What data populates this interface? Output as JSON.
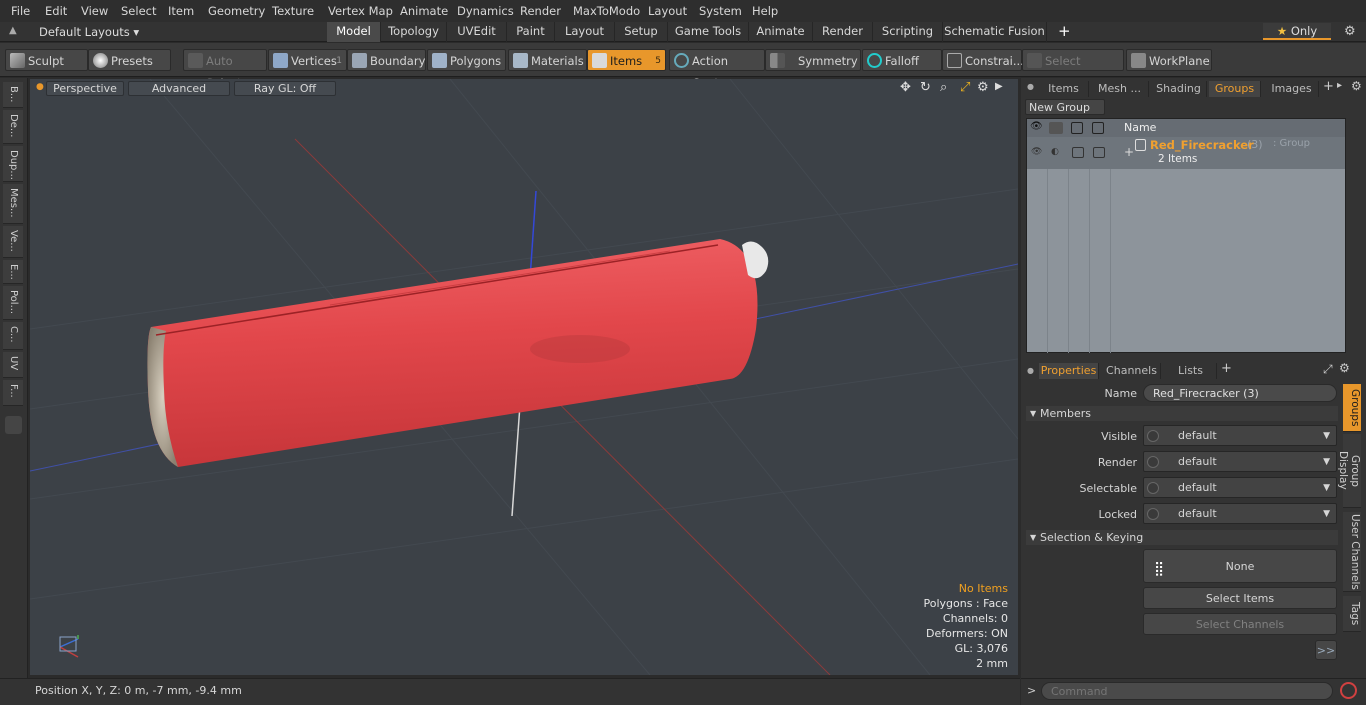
{
  "menu": [
    "File",
    "Edit",
    "View",
    "Select",
    "Item",
    "Geometry",
    "Texture",
    "Vertex Map",
    "Animate",
    "Dynamics",
    "Render",
    "MaxToModo",
    "Layout",
    "System",
    "Help"
  ],
  "layouts": {
    "selector": "Default Layouts",
    "tabs": [
      "Model",
      "Topology",
      "UVEdit",
      "Paint",
      "Layout",
      "Setup",
      "Game Tools",
      "Animate",
      "Render",
      "Scripting",
      "Schematic Fusion"
    ],
    "add": "+",
    "only": "Only"
  },
  "toolbar": {
    "sculpt": "Sculpt",
    "presets": "Presets",
    "auto_select": "Auto Select",
    "vertices": "Vertices",
    "vertices_count": "1",
    "boundary": "Boundary",
    "polygons": "Polygons",
    "materials": "Materials",
    "items": "Items",
    "items_count": "5",
    "action_center": "Action Center",
    "symmetry": "Symmetry",
    "falloff": "Falloff",
    "constrain": "Constrai...",
    "select_through": "Select Through",
    "workplane": "WorkPlane"
  },
  "left_tabs": [
    "B...",
    "De...",
    "Dup...",
    "Mes...",
    "Ve...",
    "E...",
    "Pol...",
    "C...",
    "UV",
    "F..."
  ],
  "viewport": {
    "perspective": "Perspective",
    "advanced": "Advanced",
    "raygl": "Ray GL: Off",
    "info": [
      "No Items",
      "Polygons : Face",
      "Channels: 0",
      "Deformers: ON",
      "GL: 3,076",
      "2 mm"
    ]
  },
  "status": {
    "position": "Position X, Y, Z:   0 m, -7 mm, -9.4 mm"
  },
  "right_tabs": [
    "Items",
    "Mesh ...",
    "Shading",
    "Groups",
    "Images"
  ],
  "groups": {
    "new_group": "New Group",
    "col_name": "Name",
    "item_name": "Red_Firecracker",
    "item_count": "(3)",
    "item_type": ": Group",
    "item_sub": "2 Items"
  },
  "prop_tabs": [
    "Properties",
    "Channels",
    "Lists"
  ],
  "properties": {
    "name_label": "Name",
    "name_value": "Red_Firecracker (3)",
    "members": "Members",
    "rows": [
      {
        "label": "Visible",
        "value": "default"
      },
      {
        "label": "Render",
        "value": "default"
      },
      {
        "label": "Selectable",
        "value": "default"
      },
      {
        "label": "Locked",
        "value": "default"
      }
    ],
    "sel_keying": "Selection & Keying",
    "none": "None",
    "select_items": "Select Items",
    "select_channels": "Select Channels",
    "more": ">>"
  },
  "side_tabs": [
    "Groups",
    "Group Display",
    "User Channels",
    "Tags"
  ],
  "command": {
    "prompt": ">",
    "placeholder": "Command"
  },
  "colors": {
    "accent": "#e8972b",
    "firecracker": "#e2474b"
  }
}
